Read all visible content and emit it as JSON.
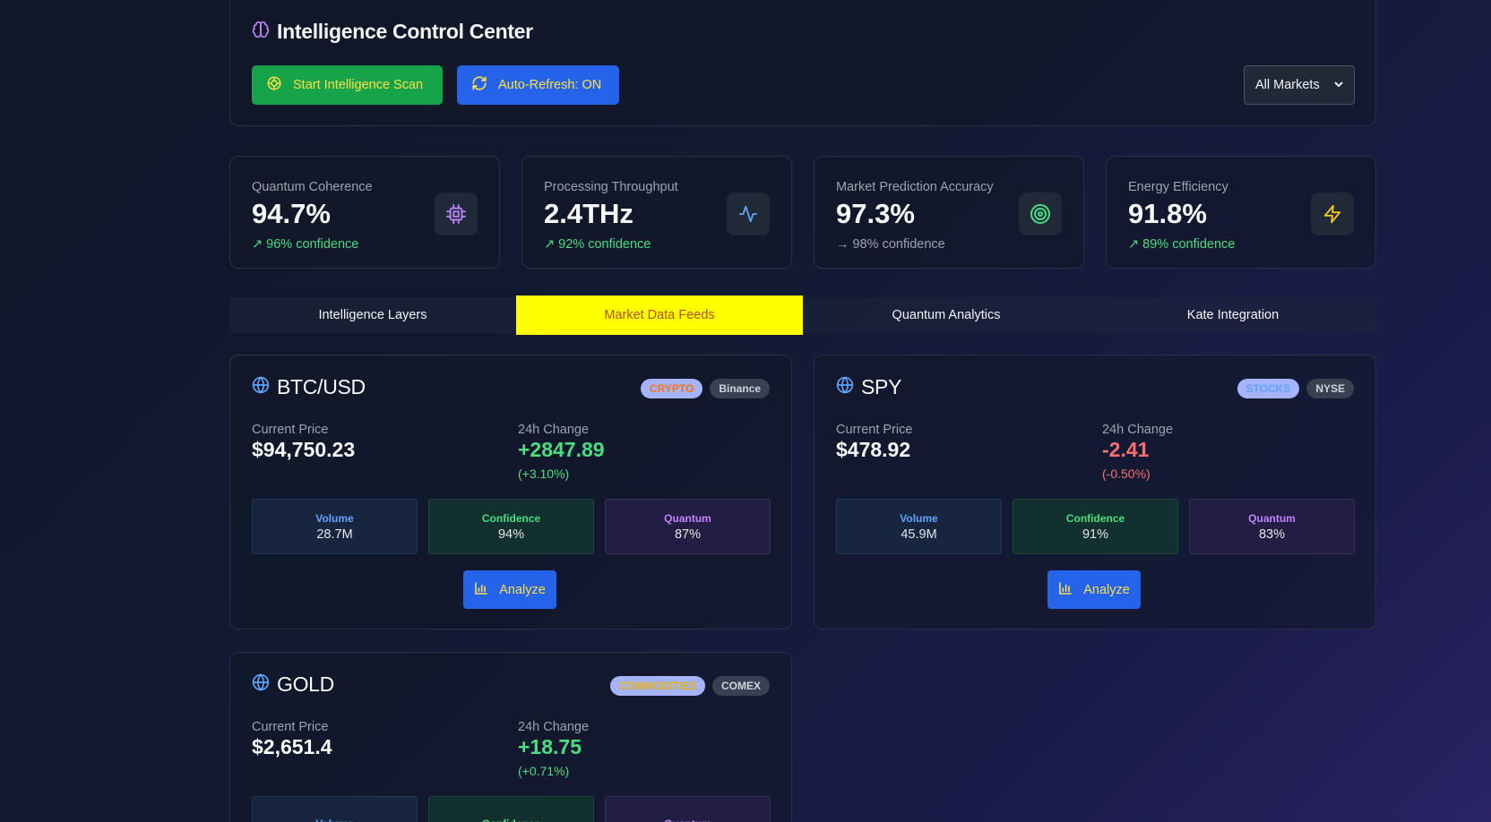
{
  "header": {
    "title": "Intelligence Control Center",
    "scan_button": "Start Intelligence Scan",
    "refresh_button": "Auto-Refresh: ON",
    "market_filter": "All Markets"
  },
  "metrics": [
    {
      "label": "Quantum Coherence",
      "value": "94.7%",
      "confidence": "↗ 96% confidence",
      "icon": "cpu-icon"
    },
    {
      "label": "Processing Throughput",
      "value": "2.4THz",
      "confidence": "↗ 92% confidence",
      "icon": "activity-icon"
    },
    {
      "label": "Market Prediction Accuracy",
      "value": "97.3%",
      "confidence": "→ 98% confidence",
      "icon": "target-icon"
    },
    {
      "label": "Energy Efficiency",
      "value": "91.8%",
      "confidence": "↗ 89% confidence",
      "icon": "lightning-icon"
    }
  ],
  "tabs": [
    {
      "label": "Intelligence Layers"
    },
    {
      "label": "Market Data Feeds"
    },
    {
      "label": "Quantum Analytics"
    },
    {
      "label": "Kate Integration"
    }
  ],
  "labels": {
    "current_price": "Current Price",
    "change_24h": "24h Change",
    "volume": "Volume",
    "confidence": "Confidence",
    "quantum": "Quantum",
    "analyze": "Analyze"
  },
  "cards": [
    {
      "symbol": "BTC/USD",
      "category": "CRYPTO",
      "category_color": "#f97316",
      "exchange": "Binance",
      "price": "$94,750.23",
      "change": "+2847.89",
      "change_pct": "(+3.10%)",
      "direction": "up",
      "volume": "28.7M",
      "confidence": "94%",
      "quantum": "87%"
    },
    {
      "symbol": "SPY",
      "category": "STOCKS",
      "category_color": "#60a5fa",
      "exchange": "NYSE",
      "price": "$478.92",
      "change": "-2.41",
      "change_pct": "(-0.50%)",
      "direction": "down",
      "volume": "45.9M",
      "confidence": "91%",
      "quantum": "83%"
    },
    {
      "symbol": "GOLD",
      "category": "COMMODITIES",
      "category_color": "#eab308",
      "exchange": "COMEX",
      "price": "$2,651.4",
      "change": "+18.75",
      "change_pct": "(+0.71%)",
      "direction": "up",
      "volume": "",
      "confidence": "",
      "quantum": ""
    }
  ]
}
